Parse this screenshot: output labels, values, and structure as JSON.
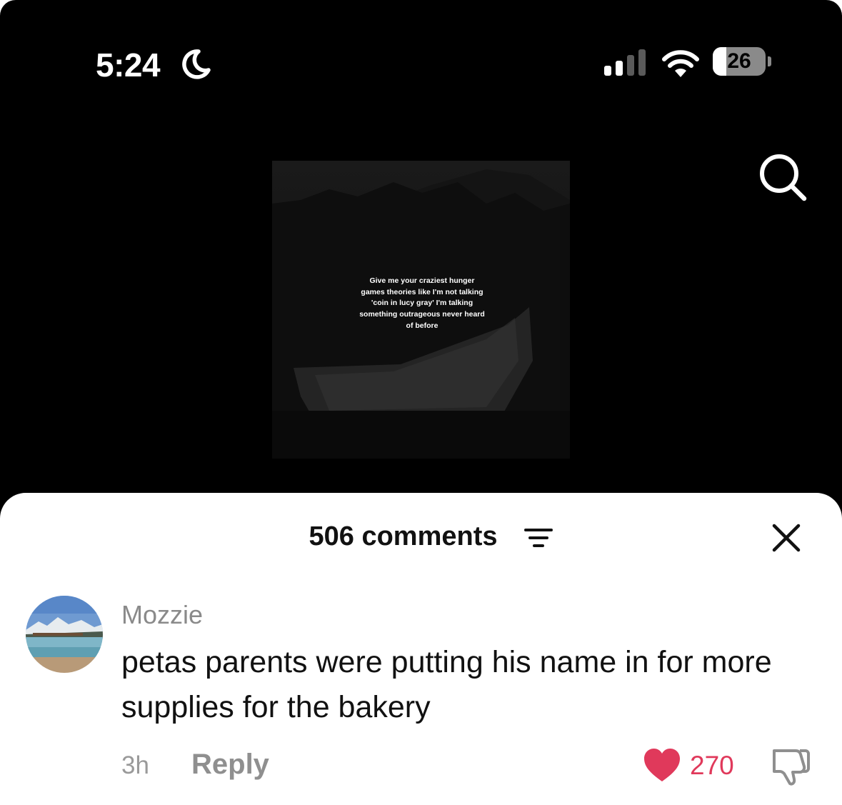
{
  "status_bar": {
    "time": "5:24",
    "battery_percent": "26",
    "battery_level": 0.26,
    "icons": [
      "moon-icon",
      "cellular-signal-icon",
      "wifi-icon",
      "battery-icon"
    ]
  },
  "header": {
    "search_icon": "search-icon"
  },
  "video": {
    "caption": "Give me your craziest hunger games theories like I'm not talking 'coin in lucy gray' I'm talking something outrageous never heard of before"
  },
  "comments_sheet": {
    "title": "506 comments",
    "filter_icon": "filter-icon",
    "close_icon": "close-icon",
    "comments": [
      {
        "username": "Mozzie",
        "text": "petas parents were putting his name in for more supplies for the bakery",
        "time_ago": "3h",
        "reply_label": "Reply",
        "likes": "270",
        "liked": true
      }
    ]
  },
  "colors": {
    "background": "#000000",
    "sheet": "#ffffff",
    "like_red": "#e0395b",
    "muted_text": "#8a8a8a"
  }
}
